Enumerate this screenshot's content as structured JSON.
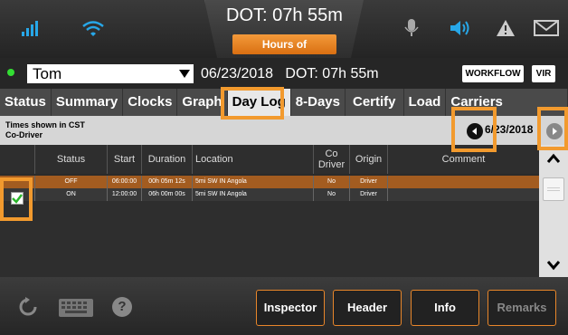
{
  "header": {
    "dot_time": "DOT: 07h 55m",
    "hos_button": "Hours of Service/VIR"
  },
  "driver": {
    "name": "Tom",
    "date_dot": "06/23/2018   DOT: 07h 55m",
    "workflow_label": "WORKFLOW",
    "vir_label": "VIR"
  },
  "tabs": [
    "Status",
    "Summary",
    "Clocks",
    "Graph",
    "Day Log",
    "8-Days",
    "Certify",
    "Load",
    "Carriers"
  ],
  "info": {
    "line1": "Times shown in CST",
    "line2": "Co-Driver",
    "nav_date": "6/23/2018"
  },
  "table": {
    "headers": [
      "Status",
      "Start",
      "Duration",
      "Location",
      "Co Driver",
      "Origin",
      "Comment"
    ],
    "rows": [
      [
        "OFF",
        "06:00:00",
        "00h 05m 12s",
        "5mi SW IN Angola",
        "No",
        "Driver",
        ""
      ],
      [
        "ON",
        "12:00:00",
        "06h 00m 00s",
        "5mi SW IN Angola",
        "No",
        "Driver",
        ""
      ]
    ]
  },
  "bottom": {
    "inspector": "Inspector",
    "header": "Header",
    "info": "Info",
    "remarks": "Remarks"
  },
  "colors": {
    "accent": "#f29a2e",
    "selected_row": "#a35c20"
  }
}
